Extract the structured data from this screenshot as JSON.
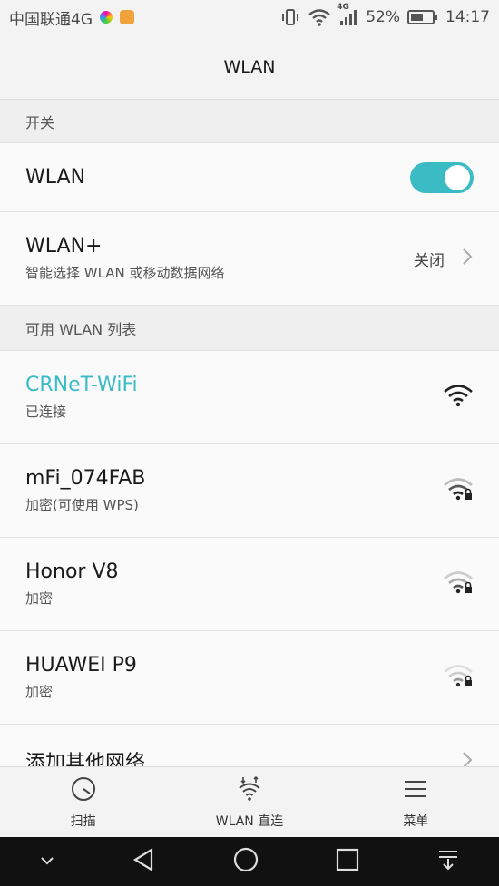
{
  "status_bar": {
    "carrier": "中国联通4G",
    "network_badge": "4G",
    "battery_percent": "52%",
    "time": "14:17",
    "icons": [
      "vibrate-icon",
      "wifi-icon",
      "signal-icon",
      "battery-icon"
    ]
  },
  "header": {
    "title": "WLAN"
  },
  "sections": {
    "switch_header": "开关",
    "list_header": "可用 WLAN 列表"
  },
  "wlan_switch": {
    "label": "WLAN",
    "enabled": true
  },
  "wlan_plus": {
    "title": "WLAN+",
    "subtitle": "智能选择 WLAN 或移动数据网络",
    "value": "关闭"
  },
  "networks": [
    {
      "name": "CRNeT-WiFi",
      "status": "已连接",
      "locked": false
    },
    {
      "name": "mFi_074FAB",
      "status": "加密(可使用 WPS)",
      "locked": true
    },
    {
      "name": "Honor V8",
      "status": "加密",
      "locked": true
    },
    {
      "name": "HUAWEI P9",
      "status": "加密",
      "locked": true
    }
  ],
  "add_network": {
    "label": "添加其他网络..."
  },
  "toolbar": {
    "scan_label": "扫描",
    "direct_label": "WLAN 直连",
    "menu_label": "菜单"
  },
  "colors": {
    "accent": "#3bbcc4",
    "nav_bg": "#111111"
  }
}
